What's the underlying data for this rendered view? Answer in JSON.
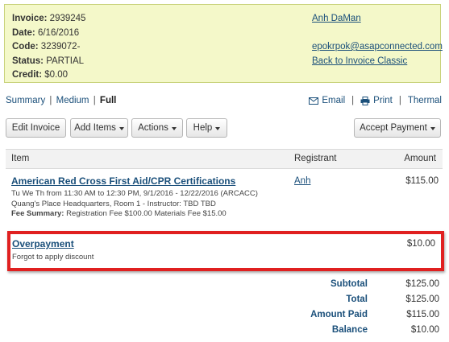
{
  "invoice": {
    "invoice_label": "Invoice:",
    "invoice_number": "2939245",
    "date_label": "Date:",
    "date": "6/16/2016",
    "code_label": "Code:",
    "code": "3239072-",
    "status_label": "Status:",
    "status": "PARTIAL",
    "credit_label": "Credit:",
    "credit": "$0.00",
    "customer_name": "Anh DaMan",
    "email": "epokrpok@asapconnected.com",
    "classic_link": "Back to Invoice Classic"
  },
  "view": {
    "summary": "Summary",
    "medium": "Medium",
    "full": "Full",
    "separator": "|"
  },
  "output": {
    "email": "Email",
    "print": "Print",
    "thermal": "Thermal",
    "separator": "|"
  },
  "buttons": {
    "edit_invoice": "Edit Invoice",
    "add_items": "Add Items",
    "actions": "Actions",
    "help": "Help",
    "accept_payment": "Accept Payment"
  },
  "table": {
    "headers": {
      "item": "Item",
      "registrant": "Registrant",
      "amount": "Amount"
    },
    "rows": [
      {
        "title": "American Red Cross First Aid/CPR Certifications",
        "schedule": "Tu We Th from 11:30 AM to 12:30 PM, 9/1/2016 - 12/22/2016 (ARCACC)",
        "location": "Quang's Place Headquarters, Room 1 - Instructor: TBD TBD",
        "fee_label": "Fee Summary:",
        "fee_detail": "Registration Fee $100.00  Materials Fee $15.00",
        "registrant": "Anh",
        "amount": "$115.00"
      },
      {
        "title": "Overpayment",
        "note": "Forgot to apply discount",
        "amount": "$10.00"
      }
    ]
  },
  "totals": {
    "subtotal_label": "Subtotal",
    "subtotal": "$125.00",
    "total_label": "Total",
    "total": "$125.00",
    "paid_label": "Amount Paid",
    "paid": "$115.00",
    "balance_label": "Balance",
    "balance": "$10.00"
  },
  "colors": {
    "info_background": "#f4f8c9",
    "link": "#1a4f7a",
    "highlight": "#e02020"
  },
  "icons": [
    "envelope-icon",
    "printer-icon",
    "caret-down-icon"
  ]
}
